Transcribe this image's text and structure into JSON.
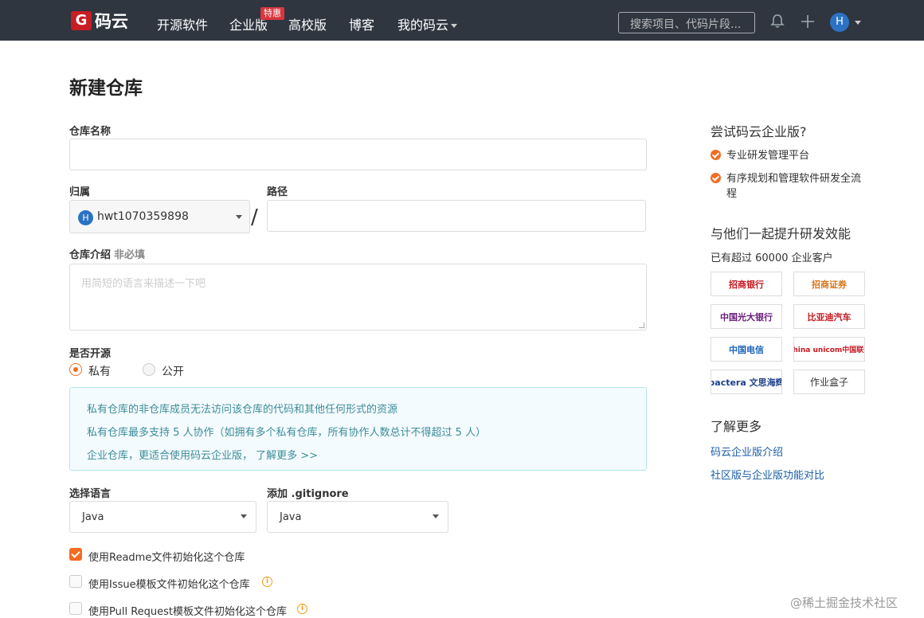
{
  "topbar": {
    "logo_text": "码云",
    "nav": [
      "开源软件",
      "企业版",
      "高校版",
      "博客",
      "我的码云"
    ],
    "hot_badge": "特惠",
    "search_placeholder": "搜索项目、代码片段...",
    "avatar_initial": "H"
  },
  "form": {
    "title": "新建仓库",
    "repo_name_label": "仓库名称",
    "owner_label": "归属",
    "owner_value": "hwt1070359898",
    "owner_avatar": "H",
    "slash": "/",
    "path_label": "路径",
    "desc_label": "仓库介绍",
    "desc_optional": "非必填",
    "desc_placeholder": "用简短的语言来描述一下吧",
    "open_label": "是否开源",
    "radio_private": "私有",
    "radio_public": "公开",
    "notice_lines": [
      "私有仓库的非仓库成员无法访问该仓库的代码和其他任何形式的资源",
      "私有仓库最多支持 5 人协作（如拥有多个私有仓库，所有协作人数总计不得超过 5 人）",
      "企业仓库，更适合使用码云企业版，  了解更多 >>"
    ],
    "language_label": "选择语言",
    "language_value": "Java",
    "gitignore_label": "添加 .gitignore",
    "gitignore_value": "Java",
    "checkboxes": [
      {
        "label": "使用Readme文件初始化这个仓库",
        "checked": true
      },
      {
        "label": "使用Issue模板文件初始化这个仓库",
        "checked": false
      },
      {
        "label": "使用Pull Request模板文件初始化这个仓库",
        "checked": false
      }
    ],
    "accent_color": "#f36c21"
  },
  "sidebar": {
    "try_heading": "尝试码云企业版?",
    "features": [
      "专业研发管理平台",
      "有序规划和管理软件研发全流程"
    ],
    "together_heading": "与他们一起提升研发效能",
    "customers_text": "已有超过 60000 企业客户",
    "customer_logos": [
      "招商银行",
      "招商证券",
      "中国光大银行",
      "比亚迪汽车",
      "中国电信",
      "China unicom中国联通",
      "pactera 文思海辉",
      "作业盒子"
    ],
    "learn_heading": "了解更多",
    "links": [
      "码云企业版介绍",
      "社区版与企业版功能对比"
    ]
  },
  "watermark": "@稀土掘金技术社区"
}
